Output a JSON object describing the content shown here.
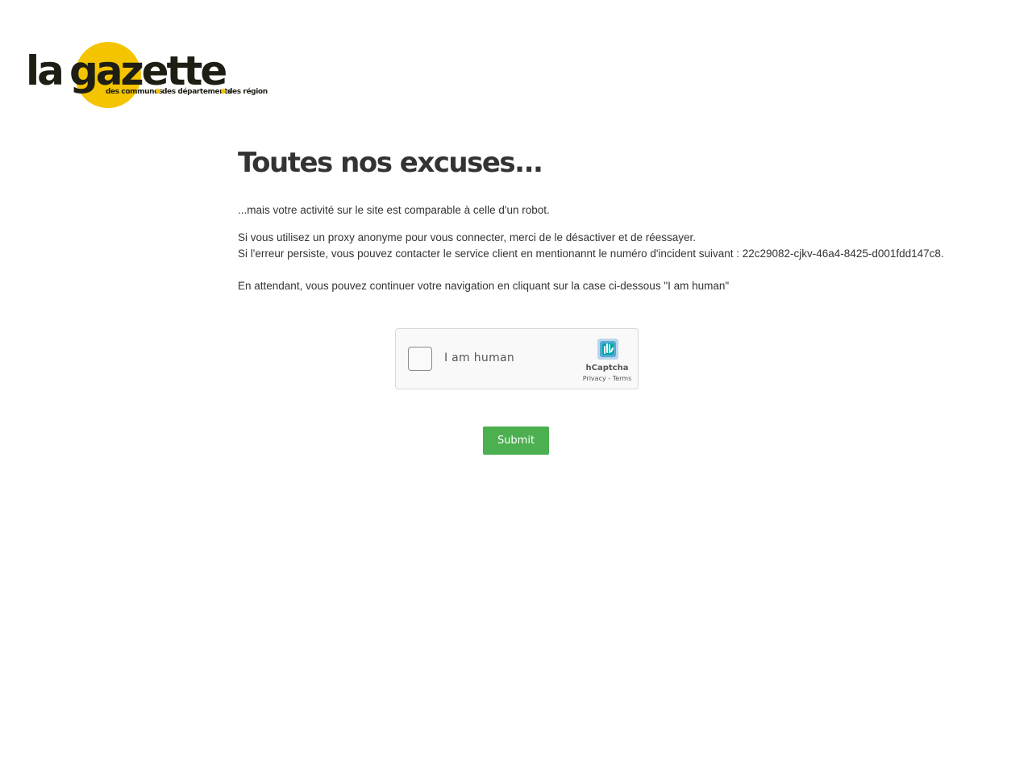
{
  "brand": {
    "logo_text_la": "la",
    "logo_text_gazette": "gazette",
    "logo_tagline_1": "des communes",
    "logo_tagline_2": "des départements",
    "logo_tagline_3": "des régions",
    "accent_color": "#f5c400",
    "text_color": "#1e1e14"
  },
  "main": {
    "title": "Toutes nos excuses...",
    "intro": "...mais votre activité sur le site est comparable à celle d'un robot.",
    "proxy_line": "Si vous utilisez un proxy anonyme pour vous connecter, merci de le désactiver et de réessayer.",
    "error_line": "Si l'erreur persiste, vous pouvez contacter le service client en mentionannt le numéro d'incident suivant : 22c29082-cjkv-46a4-8425-d001fdd147c8.",
    "waiting_line": "En attendant, vous pouvez continuer votre navigation en cliquant sur la case ci-dessous \"I am human\""
  },
  "captcha": {
    "label": "I am human",
    "brand": "hCaptcha",
    "privacy": "Privacy",
    "separator": " - ",
    "terms": "Terms",
    "icon": "hcaptcha-hand-icon",
    "icon_color": "#0074bf"
  },
  "form": {
    "submit_label": "Submit",
    "submit_color": "#4caf50"
  }
}
